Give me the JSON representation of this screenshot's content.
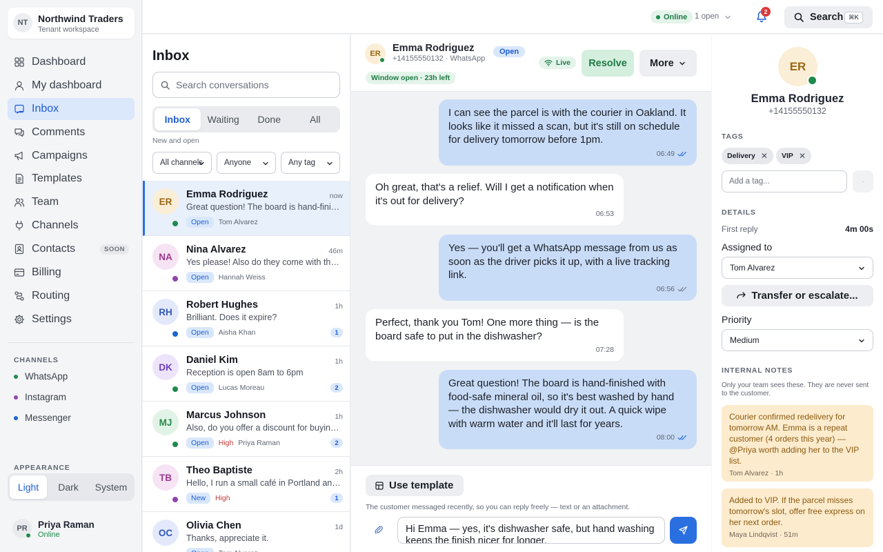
{
  "workspace": {
    "initials": "NT",
    "name": "Northwind Traders",
    "subtitle": "Tenant workspace"
  },
  "nav": [
    {
      "label": "Dashboard",
      "icon": "dashboard-icon"
    },
    {
      "label": "My dashboard",
      "icon": "user-icon"
    },
    {
      "label": "Inbox",
      "icon": "inbox-icon",
      "active": true
    },
    {
      "label": "Comments",
      "icon": "comments-icon"
    },
    {
      "label": "Campaigns",
      "icon": "megaphone-icon"
    },
    {
      "label": "Templates",
      "icon": "template-icon"
    },
    {
      "label": "Team",
      "icon": "team-icon"
    },
    {
      "label": "Channels",
      "icon": "plug-icon"
    },
    {
      "label": "Contacts",
      "icon": "contacts-icon",
      "badge": "SOON"
    },
    {
      "label": "Billing",
      "icon": "billing-icon"
    },
    {
      "label": "Routing",
      "icon": "routing-icon"
    },
    {
      "label": "Settings",
      "icon": "gear-icon"
    }
  ],
  "channels": {
    "title": "CHANNELS",
    "items": [
      {
        "label": "WhatsApp",
        "color": "#1f8a4c"
      },
      {
        "label": "Instagram",
        "color": "#8e44ad"
      },
      {
        "label": "Messenger",
        "color": "#1a66cc"
      }
    ]
  },
  "appearance": {
    "title": "APPEARANCE",
    "options": [
      "Light",
      "Dark",
      "System"
    ],
    "selected": "Light"
  },
  "me": {
    "initials": "PR",
    "name": "Priya Raman",
    "status": "Online"
  },
  "topbar": {
    "online": "Online",
    "open_count": "1 open",
    "notifications": "2",
    "search_label": "Search",
    "shortcut": "⌘K"
  },
  "inbox": {
    "title": "Inbox",
    "search_placeholder": "Search conversations",
    "tabs": [
      "Inbox",
      "Waiting",
      "Done",
      "All"
    ],
    "active_tab": "Inbox",
    "subtitle": "New and open",
    "filters": [
      "All channels",
      "Anyone",
      "Any tag"
    ],
    "conversations": [
      {
        "initials": "ER",
        "name": "Emma Rodriguez",
        "time": "now",
        "preview": "Great question! The board is hand-finished with food-safe mineral oil",
        "status": "Open",
        "priority": "",
        "agent": "Tom Alvarez",
        "unread": "",
        "channel_color": "#1f8a4c",
        "avatar_bg": "#fbeed6",
        "avatar_fg": "#9a6714",
        "selected": true
      },
      {
        "initials": "NA",
        "name": "Nina Alvarez",
        "time": "46m",
        "preview": "Yes please! Also do they come with the gift box?",
        "status": "Open",
        "priority": "",
        "agent": "Hannah Weiss",
        "unread": "",
        "channel_color": "#8e44ad",
        "avatar_bg": "#f6e3f3",
        "avatar_fg": "#9b3a8c"
      },
      {
        "initials": "RH",
        "name": "Robert Hughes",
        "time": "1h",
        "preview": "Brilliant. Does it expire?",
        "status": "Open",
        "priority": "",
        "agent": "Aisha Khan",
        "unread": "1",
        "channel_color": "#1a66cc",
        "avatar_bg": "#e3e9fb",
        "avatar_fg": "#3558b8"
      },
      {
        "initials": "DK",
        "name": "Daniel Kim",
        "time": "1h",
        "preview": "Reception is open 8am to 6pm",
        "status": "Open",
        "priority": "",
        "agent": "Lucas Moreau",
        "unread": "2",
        "channel_color": "#1f8a4c",
        "avatar_bg": "#ede4fb",
        "avatar_fg": "#6d3fc0"
      },
      {
        "initials": "MJ",
        "name": "Marcus Johnson",
        "time": "1h",
        "preview": "Also, do you offer a discount for buying in bulk?",
        "status": "Open",
        "priority": "High",
        "agent": "Priya Raman",
        "unread": "2",
        "channel_color": "#1f8a4c",
        "avatar_bg": "#e1f3e6",
        "avatar_fg": "#2a8a4e"
      },
      {
        "initials": "TB",
        "name": "Theo Baptiste",
        "time": "2h",
        "preview": "Hello, I run a small café in Portland and I'd love to stock your boards",
        "status": "New",
        "priority": "High",
        "agent": "",
        "unread": "1",
        "channel_color": "#8e44ad",
        "avatar_bg": "#f6e3f3",
        "avatar_fg": "#9b3a8c"
      },
      {
        "initials": "OC",
        "name": "Olivia Chen",
        "time": "1d",
        "preview": "Thanks, appreciate it.",
        "status": "Open",
        "priority": "",
        "agent": "Tom Alvarez",
        "unread": "",
        "channel_color": "#1a66cc",
        "avatar_bg": "#e3e9fb",
        "avatar_fg": "#3558b8"
      }
    ]
  },
  "chat": {
    "initials": "ER",
    "name": "Emma Rodriguez",
    "subtitle": "+14155550132 · WhatsApp",
    "status": "Open",
    "window": "Window open · 23h left",
    "live": "Live",
    "resolve": "Resolve",
    "more": "More",
    "messages": [
      {
        "dir": "out",
        "text": "I can see the parcel is with the courier in Oakland. It looks like it missed a scan, but it's still on schedule for delivery tomorrow before 1pm.",
        "time": "06:49",
        "read": true
      },
      {
        "dir": "in",
        "text": "Oh great, that's a relief. Will I get a notification when it's out for delivery?",
        "time": "06:53"
      },
      {
        "dir": "out",
        "text": "Yes — you'll get a WhatsApp message from us as soon as the driver picks it up, with a live tracking link.",
        "time": "06:56",
        "read": false
      },
      {
        "dir": "in",
        "text": "Perfect, thank you Tom! One more thing — is the board safe to put in the dishwasher?",
        "time": "07:28"
      },
      {
        "dir": "out",
        "text": "Great question! The board is hand-finished with food-safe mineral oil, so it's best washed by hand — the dishwasher would dry it out. A quick wipe with warm water and it'll last for years.",
        "time": "08:00",
        "read": true
      }
    ],
    "composer": {
      "template_label": "Use template",
      "hint": "The customer messaged recently, so you can reply freely — text or an attachment.",
      "draft": "Hi Emma — yes, it's dishwasher safe, but hand washing keeps the finish nicer for longer."
    }
  },
  "details": {
    "initials": "ER",
    "name": "Emma Rodriguez",
    "phone": "+14155550132",
    "tags_title": "TAGS",
    "tags": [
      "Delivery",
      "VIP"
    ],
    "tag_placeholder": "Add a tag...",
    "details_title": "DETAILS",
    "first_reply_label": "First reply",
    "first_reply_value": "4m 00s",
    "assigned_label": "Assigned to",
    "assigned_value": "Tom Alvarez",
    "transfer_label": "Transfer or escalate...",
    "priority_label": "Priority",
    "priority_value": "Medium",
    "notes_title": "INTERNAL NOTES",
    "notes_hint": "Only your team sees these. They are never sent to the customer.",
    "notes": [
      {
        "text": "Courier confirmed redelivery for tomorrow AM. Emma is a repeat customer (4 orders this year) — @Priya worth adding her to the VIP list.",
        "meta": "Tom Alvarez · 1h"
      },
      {
        "text": "Added to VIP. If the parcel misses tomorrow's slot, offer free express on her next order.",
        "meta": "Maya Lindqvist · 51m"
      }
    ]
  }
}
